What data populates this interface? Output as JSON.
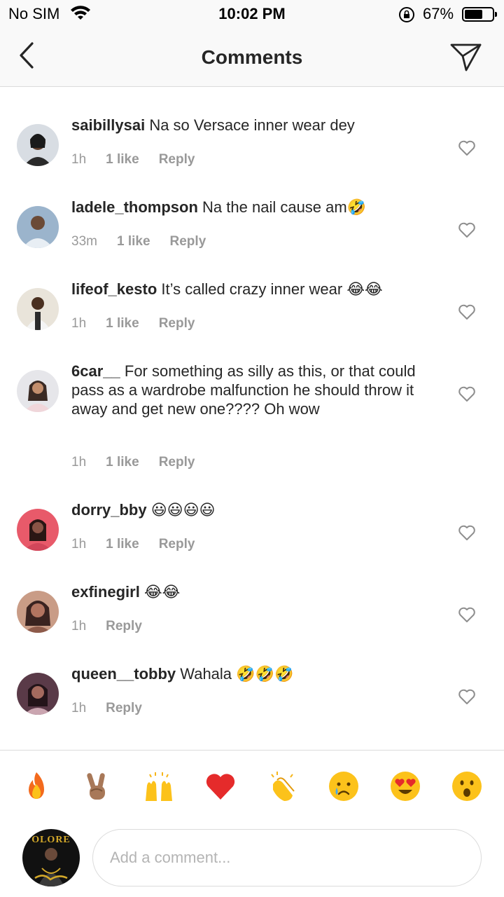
{
  "status_bar": {
    "carrier": "No SIM",
    "time": "10:02 PM",
    "battery": "67%",
    "battery_level": 0.67
  },
  "nav": {
    "title": "Comments",
    "back_icon": "chevron-left-icon",
    "share_icon": "paper-plane-icon"
  },
  "comments": [
    {
      "user": "saibillysai",
      "text": "Na so Versace inner wear dey",
      "time": "1h",
      "likes": "1 like",
      "reply": "Reply"
    },
    {
      "user": "ladele_thompson",
      "text": "Na the nail cause am🤣",
      "time": "33m",
      "likes": "1 like",
      "reply": "Reply"
    },
    {
      "user": "lifeof_kesto",
      "text": "It’s called crazy inner wear 😂😂",
      "time": "1h",
      "likes": "1 like",
      "reply": "Reply"
    },
    {
      "user": "6car__",
      "text": "For something as silly as this, or that could pass as a wardrobe malfunction he should throw it away and get new one???? Oh wow",
      "time": "1h",
      "likes": "1 like",
      "reply": "Reply"
    },
    {
      "user": "dorry_bby",
      "text": "😃😃😃😃",
      "time": "1h",
      "likes": "1 like",
      "reply": "Reply"
    },
    {
      "user": "exfinegirl",
      "text": "😂😂",
      "time": "1h",
      "likes": "",
      "reply": "Reply"
    },
    {
      "user": "queen__tobby",
      "text": "Wahala 🤣🤣🤣",
      "time": "1h",
      "likes": "",
      "reply": "Reply"
    }
  ],
  "reactions": [
    "🔥",
    "✌🏽",
    "🙌",
    "❤️",
    "👏",
    "😢",
    "😍",
    "😮"
  ],
  "composer": {
    "placeholder": "Add a comment...",
    "avatar_logo_text": "OLORE"
  },
  "colors": {
    "heart_outline": "#8e8e8e",
    "meta_gray": "#999999",
    "text": "#262626"
  }
}
